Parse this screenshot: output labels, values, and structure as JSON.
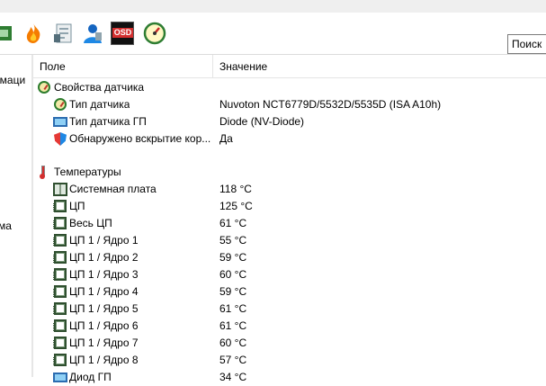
{
  "toolbar": {
    "icons": [
      "cpu-chip-icon",
      "flame-icon",
      "benchmark-icon",
      "user-icon",
      "osd-icon",
      "gauge-icon"
    ],
    "osd_label": "OSD",
    "search_placeholder": "Поиск"
  },
  "left_pane": {
    "fragments": [
      "рмаци",
      "ма"
    ]
  },
  "list": {
    "columns": [
      "Поле",
      "Значение"
    ],
    "groups": [
      {
        "title": "Свойства датчика",
        "icon": "gauge-icon",
        "rows": [
          {
            "icon": "gauge-icon",
            "field": "Тип датчика",
            "value": "Nuvoton NCT6779D/5532D/5535D  (ISA A10h)"
          },
          {
            "icon": "monitor-icon",
            "field": "Тип датчика ГП",
            "value": "Diode  (NV-Diode)"
          },
          {
            "icon": "shield-icon",
            "field": "Обнаружено вскрытие кор...",
            "value": "Да"
          }
        ]
      },
      {
        "title": "Температуры",
        "icon": "thermometer-icon",
        "rows": [
          {
            "icon": "motherboard-icon",
            "field": "Системная плата",
            "value": "118 °C"
          },
          {
            "icon": "cpu-chip-icon",
            "field": "ЦП",
            "value": "125 °C"
          },
          {
            "icon": "cpu-chip-icon",
            "field": "Весь ЦП",
            "value": "61 °C"
          },
          {
            "icon": "cpu-chip-icon",
            "field": "ЦП 1 / Ядро 1",
            "value": "55 °C"
          },
          {
            "icon": "cpu-chip-icon",
            "field": "ЦП 1 / Ядро 2",
            "value": "59 °C"
          },
          {
            "icon": "cpu-chip-icon",
            "field": "ЦП 1 / Ядро 3",
            "value": "60 °C"
          },
          {
            "icon": "cpu-chip-icon",
            "field": "ЦП 1 / Ядро 4",
            "value": "59 °C"
          },
          {
            "icon": "cpu-chip-icon",
            "field": "ЦП 1 / Ядро 5",
            "value": "61 °C"
          },
          {
            "icon": "cpu-chip-icon",
            "field": "ЦП 1 / Ядро 6",
            "value": "61 °C"
          },
          {
            "icon": "cpu-chip-icon",
            "field": "ЦП 1 / Ядро 7",
            "value": "60 °C"
          },
          {
            "icon": "cpu-chip-icon",
            "field": "ЦП 1 / Ядро 8",
            "value": "57 °C"
          },
          {
            "icon": "monitor-icon",
            "field": "Диод ГП",
            "value": "34 °C"
          }
        ]
      }
    ]
  }
}
